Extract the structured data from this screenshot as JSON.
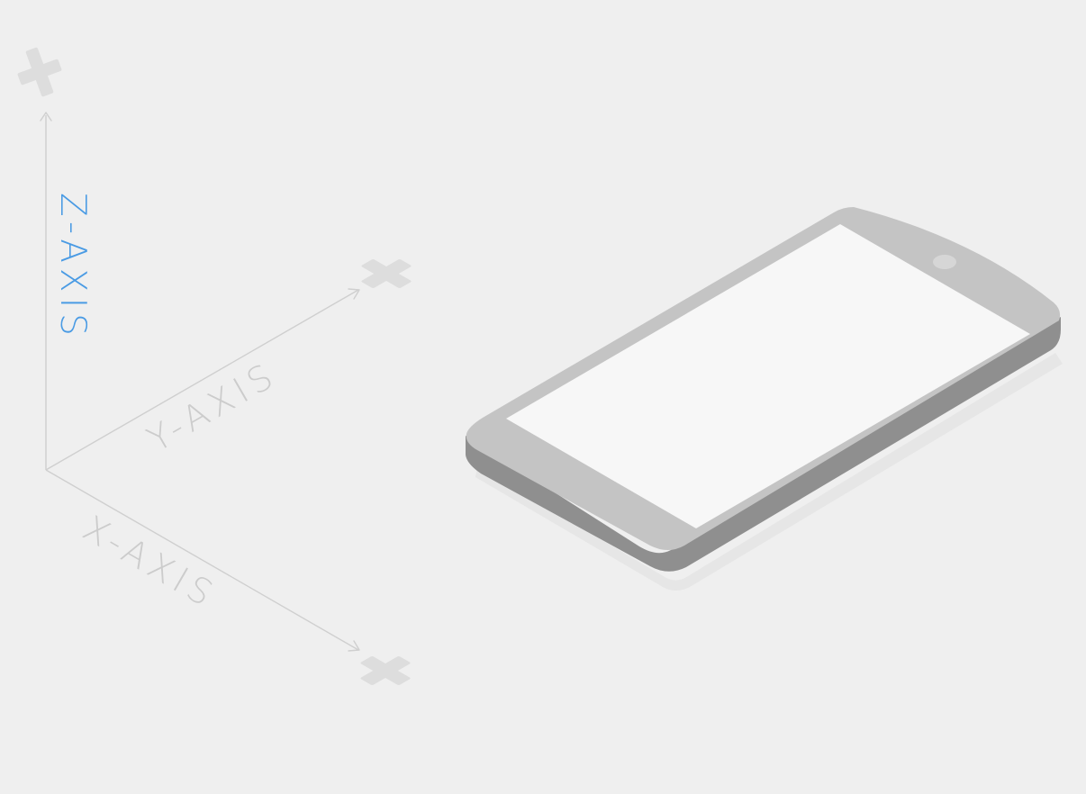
{
  "axes": {
    "x_label": "X-AXIS",
    "y_label": "Y-AXIS",
    "z_label": "Z-AXIS",
    "positive_symbol": "+"
  },
  "colors": {
    "background": "#efefef",
    "axis_line": "#cfcfcf",
    "axis_label_inactive": "#cccccc",
    "axis_label_active": "#4a9be4",
    "plus_sign": "#dddddd",
    "phone_body": "#c4c4c4",
    "phone_side": "#8f8f8f",
    "phone_screen": "#f7f7f7",
    "phone_camera": "#d6d6d6"
  },
  "highlighted_axis": "z",
  "icons": [
    "plus-icon",
    "arrow-icon",
    "phone-icon"
  ]
}
